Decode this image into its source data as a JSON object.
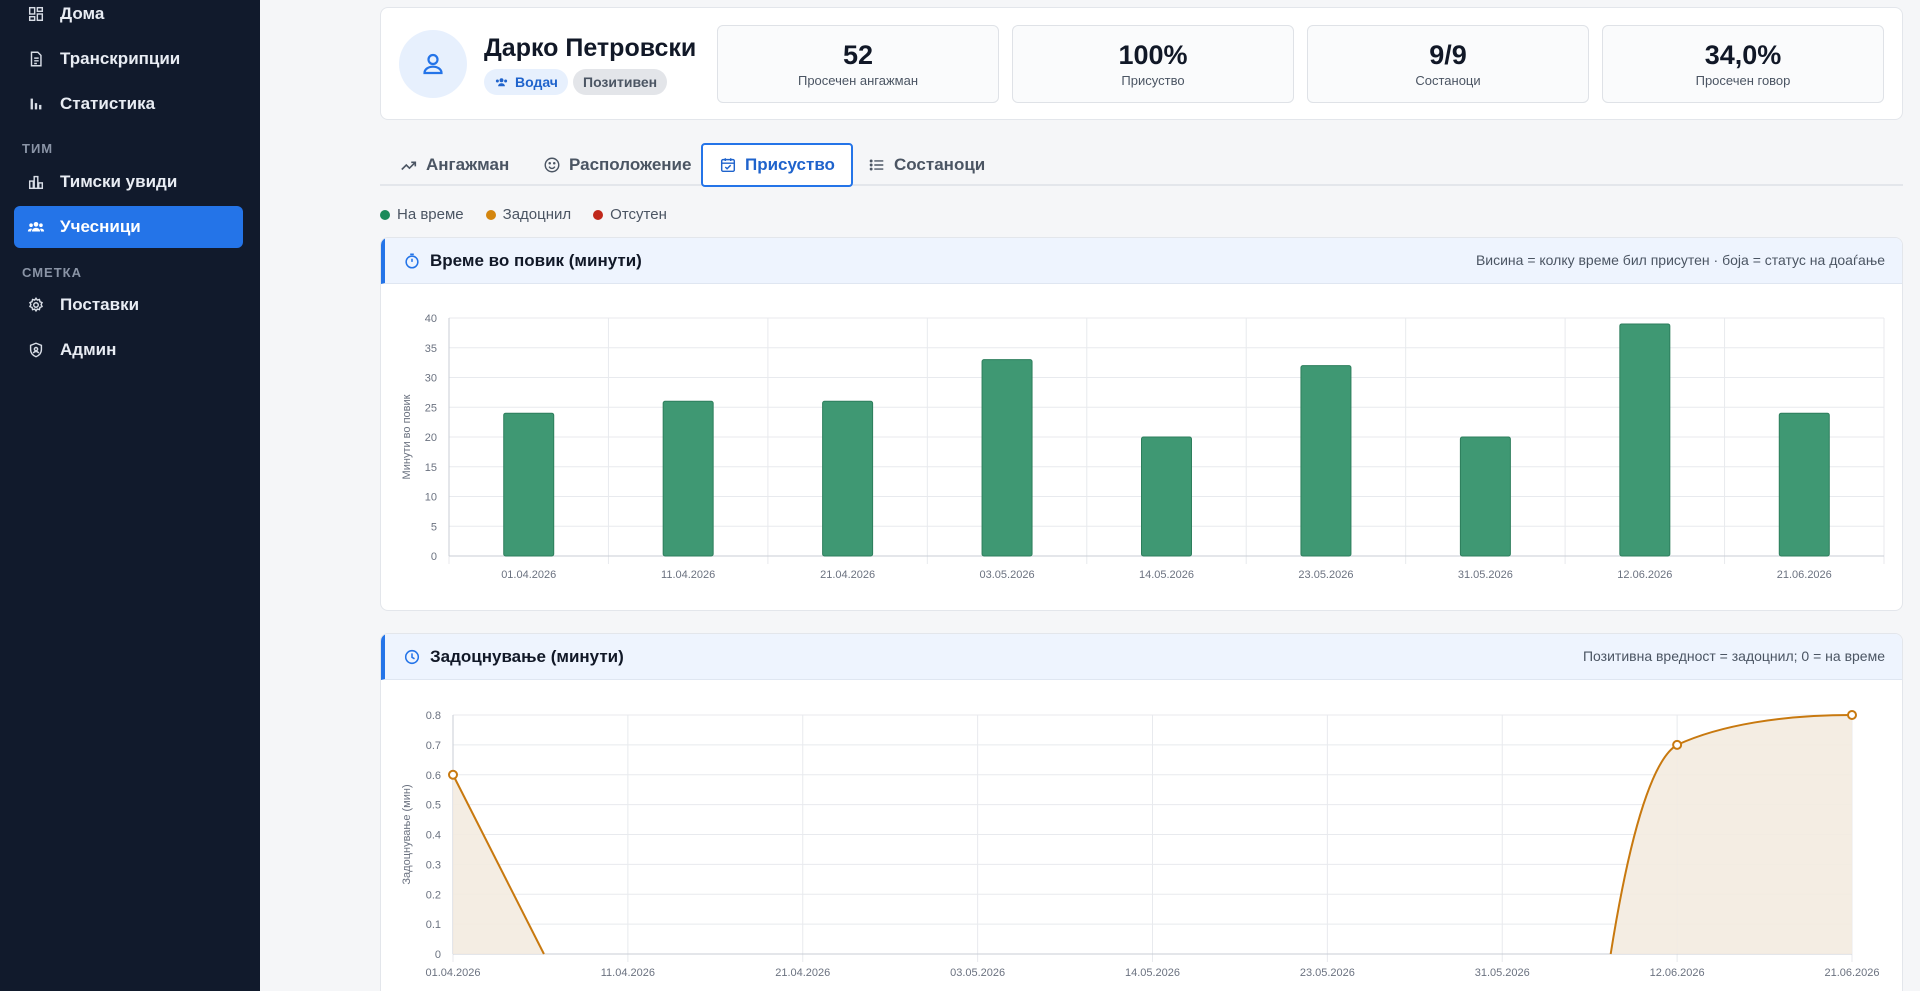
{
  "sidebar": {
    "items_top": [
      {
        "label": "Дома",
        "icon": "dashboard-icon"
      },
      {
        "label": "Транскрипции",
        "icon": "document-icon"
      },
      {
        "label": "Статистика",
        "icon": "bar-chart-icon"
      }
    ],
    "section_team": "ТИМ",
    "items_team": [
      {
        "label": "Тимски увиди",
        "icon": "team-insights-icon"
      },
      {
        "label": "Учесници",
        "icon": "participants-icon",
        "active": true
      }
    ],
    "section_account": "СМЕТКА",
    "items_account": [
      {
        "label": "Поставки",
        "icon": "gear-icon"
      },
      {
        "label": "Админ",
        "icon": "shield-icon"
      }
    ]
  },
  "profile": {
    "name": "Дарко Петровски",
    "role_badge": "Водач",
    "sentiment_badge": "Позитивен",
    "stats": [
      {
        "value": "52",
        "label": "Просечен ангажман"
      },
      {
        "value": "100%",
        "label": "Присуство"
      },
      {
        "value": "9/9",
        "label": "Состаноци"
      },
      {
        "value": "34,0%",
        "label": "Просечен говор"
      }
    ]
  },
  "tabs": [
    {
      "label": "Ангажман",
      "icon": "trend-icon"
    },
    {
      "label": "Расположение",
      "icon": "smile-icon"
    },
    {
      "label": "Присуство",
      "icon": "calendar-check-icon",
      "active": true
    },
    {
      "label": "Состаноци",
      "icon": "list-icon"
    }
  ],
  "legend": [
    {
      "label": "На време",
      "color": "#1a8a5a"
    },
    {
      "label": "Задоцнил",
      "color": "#d4860f"
    },
    {
      "label": "Отсутен",
      "color": "#c0281b"
    }
  ],
  "charts": {
    "time_in_call": {
      "title": "Време во повик (минути)",
      "note": "Висина = колку време бил присутен · боја = статус на доаѓање"
    },
    "lateness": {
      "title": "Задоцнување (минути)",
      "note": "Позитивна вредност = задоцнил; 0 = на време"
    }
  },
  "chart_data": [
    {
      "type": "bar",
      "title": "Време во повик (минути)",
      "ylabel": "Минути во повик",
      "xlabel": "",
      "categories": [
        "01.04.2026",
        "11.04.2026",
        "21.04.2026",
        "03.05.2026",
        "14.05.2026",
        "23.05.2026",
        "31.05.2026",
        "12.06.2026",
        "21.06.2026"
      ],
      "values": [
        24,
        26,
        26,
        33,
        20,
        32,
        20,
        39,
        24
      ],
      "ylim": [
        0,
        40
      ],
      "yticks": [
        0,
        5,
        10,
        15,
        20,
        25,
        30,
        35,
        40
      ],
      "bar_color": "#3f9873",
      "grid": true
    },
    {
      "type": "line",
      "title": "Задоцнување (минути)",
      "ylabel": "Задоцнување (мин)",
      "xlabel": "",
      "categories": [
        "01.04.2026",
        "11.04.2026",
        "21.04.2026",
        "03.05.2026",
        "14.05.2026",
        "23.05.2026",
        "31.05.2026",
        "12.06.2026",
        "21.06.2026"
      ],
      "values": [
        0.6,
        0,
        0,
        0,
        0,
        0,
        0,
        0.7,
        0.8
      ],
      "ylim": [
        0,
        0.8
      ],
      "yticks": [
        "0",
        "0.1",
        "0.2",
        "0.3",
        "0.4",
        "0.5",
        "0.6",
        "0.7",
        "0.8"
      ],
      "line_color": "#c8790f",
      "fill": true,
      "grid": true
    }
  ]
}
